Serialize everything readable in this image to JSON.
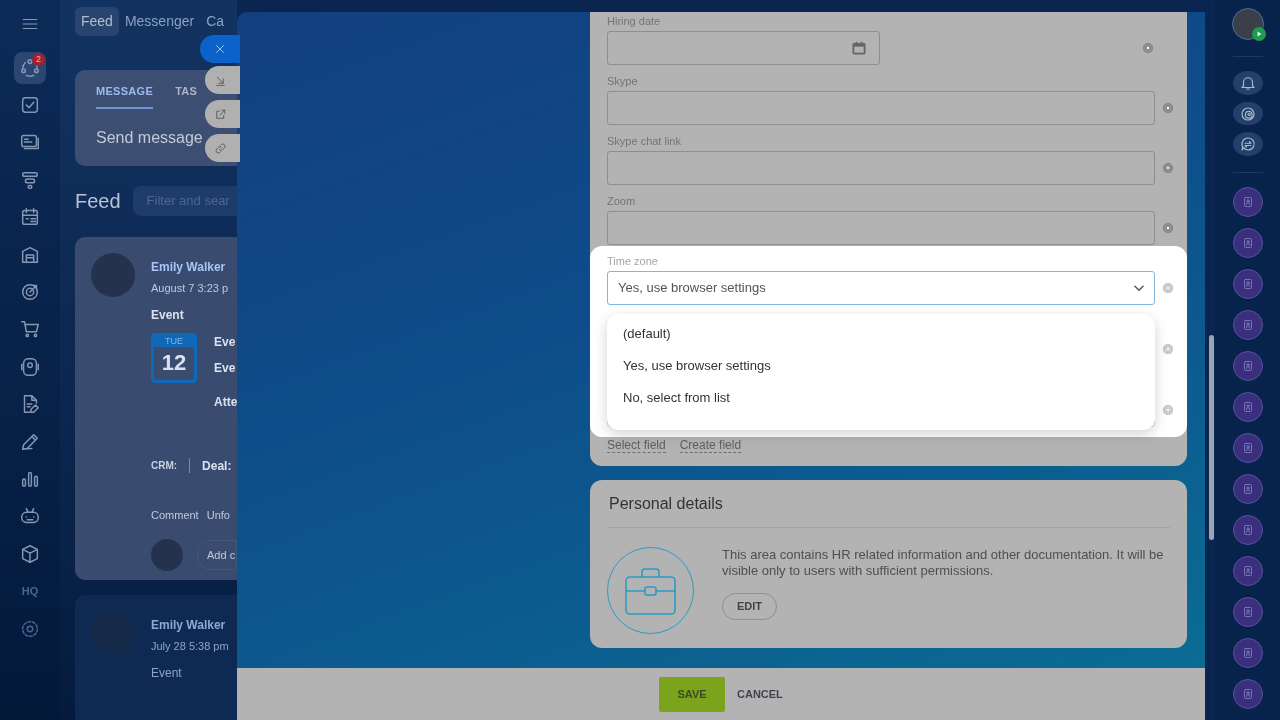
{
  "left_sidebar": {
    "items": [
      {
        "selected": true,
        "badge": "2"
      },
      {
        "selected": false
      },
      {
        "selected": false
      },
      {
        "selected": false
      },
      {
        "selected": false
      },
      {
        "selected": false
      },
      {
        "selected": false
      },
      {
        "selected": false
      },
      {
        "selected": false
      },
      {
        "selected": false
      },
      {
        "selected": false
      },
      {
        "selected": false
      },
      {
        "selected": false
      },
      {
        "selected": false
      },
      {
        "selected": false,
        "label": "HQ"
      },
      {
        "selected": false
      }
    ]
  },
  "top_nav": {
    "tabs": [
      {
        "label": "Feed",
        "selected": true
      },
      {
        "label": "Messenger",
        "selected": false
      },
      {
        "label": "Ca",
        "selected": false
      }
    ]
  },
  "composer": {
    "tabs": [
      {
        "label": "MESSAGE",
        "selected": true
      },
      {
        "label": "TAS",
        "selected": false
      }
    ],
    "placeholder": "Send message"
  },
  "feed": {
    "title": "Feed",
    "filter_placeholder": "Filter and sear",
    "posts": [
      {
        "author": "Emily Walker",
        "time": "August 7 3:23 p",
        "type": "Event",
        "event": {
          "weekday": "TUE",
          "day": "12",
          "lines": [
            "Eve",
            "Eve",
            "Atte"
          ]
        },
        "crm_label": "CRM:",
        "crm_value": "Deal:",
        "actions": [
          "Comment",
          "Unfo"
        ],
        "comment_placeholder": "Add c"
      },
      {
        "author": "Emily Walker",
        "time": "July 28 5:38 pm",
        "type": "Event"
      }
    ]
  },
  "form": {
    "fields": [
      {
        "label": "Hiring date",
        "kind": "date"
      },
      {
        "label": "Skype",
        "kind": "text"
      },
      {
        "label": "Skype chat link",
        "kind": "text"
      },
      {
        "label": "Zoom",
        "kind": "text"
      }
    ],
    "time_zone": {
      "label": "Time zone",
      "value": "Yes, use browser settings",
      "expanded": true,
      "options": [
        "(default)",
        "Yes, use browser settings",
        "No, select from list"
      ]
    },
    "links": [
      "Select field",
      "Create field"
    ]
  },
  "personal_details": {
    "title": "Personal details",
    "text": "This area contains HR related information and other documentation. It will be visible only to users with sufficient permissions.",
    "button": "EDIT"
  },
  "footer": {
    "save": "SAVE",
    "cancel": "CANCEL"
  }
}
